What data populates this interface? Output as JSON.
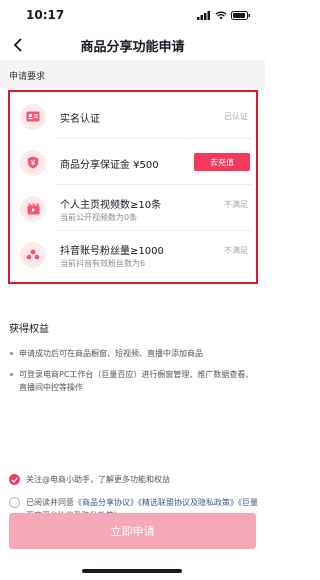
{
  "status_bar": {
    "time": "10:17"
  },
  "nav": {
    "title": "商品分享功能申请"
  },
  "requirements": {
    "heading": "申请要求",
    "items": [
      {
        "title": "实名认证",
        "status": "已认证",
        "icon": "id-card-icon"
      },
      {
        "title": "商品分享保证金 ¥500",
        "action": "去充值",
        "icon": "shield-icon"
      },
      {
        "title": "个人主页视频数≥10条",
        "sub": "当前公开视频数为0条",
        "status": "不满足",
        "icon": "video-icon"
      },
      {
        "title": "抖音账号粉丝量≥1000",
        "sub": "当前抖音有效粉丝数为6",
        "status": "不满足",
        "icon": "fans-icon"
      }
    ]
  },
  "benefits": {
    "heading": "获得权益",
    "items": [
      "申请成功后可在商品橱窗、短视频、直播中添加商品",
      "可登录电商PC工作台（巨量百应）进行橱窗管理、推广数据查看、直播间中控等操作"
    ]
  },
  "agreements": {
    "follow_text": "关注@电商小助手，了解更多功能和权益",
    "read_prefix": "已阅读并同意",
    "link1": "《商品分享协议》",
    "link2": "《精选联盟协议及隐私政策》",
    "link3": "《巨量百应平台协议及隐私政策》"
  },
  "submit": {
    "label": "立即申请"
  },
  "colors": {
    "accent": "#f33a5a",
    "highlight_border": "#e3162a",
    "disabled_button": "#f7a8b8"
  }
}
